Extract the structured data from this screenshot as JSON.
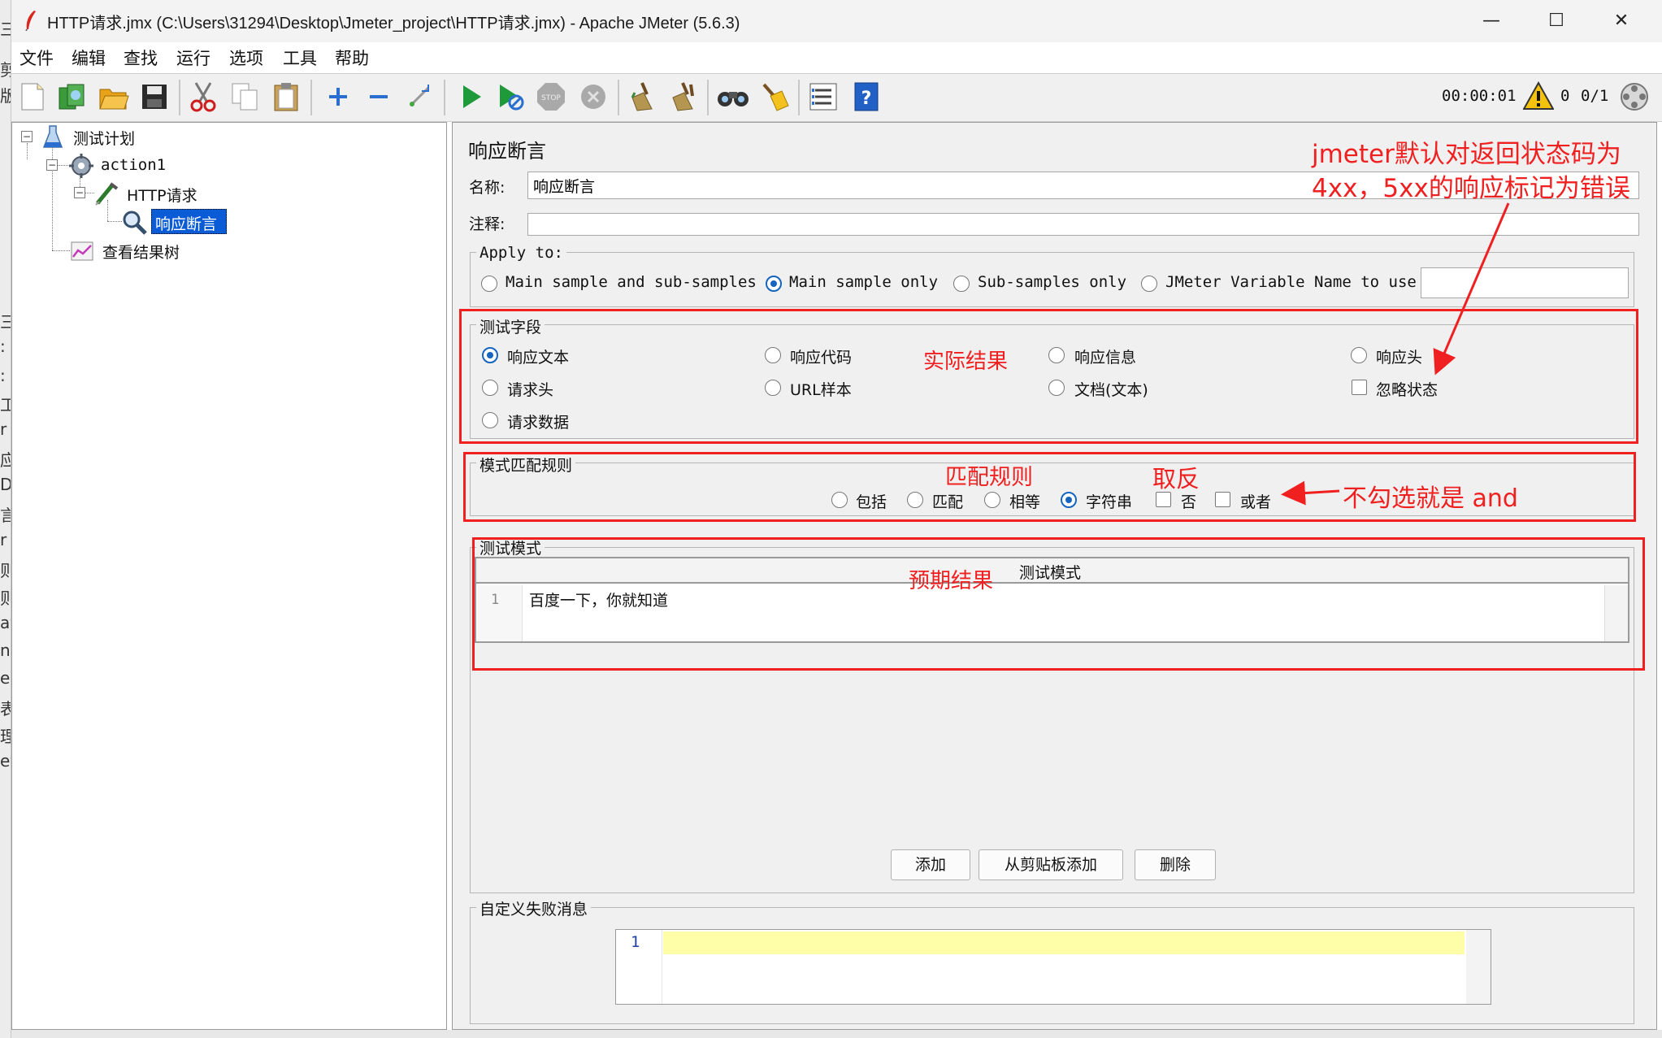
{
  "window": {
    "title": "HTTP请求.jmx (C:\\Users\\31294\\Desktop\\Jmeter_project\\HTTP请求.jmx) - Apache JMeter (5.6.3)",
    "minimize": "—",
    "maximize": "☐",
    "close": "✕"
  },
  "menu": [
    "文件",
    "编辑",
    "查找",
    "运行",
    "选项",
    "工具",
    "帮助"
  ],
  "toolbar": {
    "icons": [
      "new-icon",
      "templates-icon",
      "open-icon",
      "save-icon",
      "cut-icon",
      "copy-icon",
      "paste-icon",
      "expand-icon",
      "collapse-icon",
      "toggle-icon",
      "start-icon",
      "start-no-pause-icon",
      "stop-icon",
      "shutdown-icon",
      "clear-icon",
      "clear-all-icon",
      "search-icon",
      "reset-search-icon",
      "function-helper-icon",
      "help-icon"
    ],
    "timer": "00:00:01",
    "warn_count": "0",
    "threads": "0/1"
  },
  "tree": {
    "items": [
      {
        "label": "测试计划",
        "icon": "test-plan-icon"
      },
      {
        "label": "action1",
        "icon": "thread-group-icon"
      },
      {
        "label": "HTTP请求",
        "icon": "sampler-icon"
      },
      {
        "label": "响应断言",
        "icon": "assertion-icon"
      },
      {
        "label": "查看结果树",
        "icon": "listener-icon"
      }
    ]
  },
  "form": {
    "heading": "响应断言",
    "name_label": "名称:",
    "name_value": "响应断言",
    "comment_label": "注释:",
    "comment_value": "",
    "apply_to": {
      "legend": "Apply to:",
      "options": [
        "Main sample and sub-samples",
        "Main sample only",
        "Sub-samples only",
        "JMeter Variable Name to use"
      ],
      "selected": "Main sample only",
      "variable_value": ""
    },
    "test_field": {
      "legend": "测试字段",
      "options": [
        "响应文本",
        "响应代码",
        "响应信息",
        "响应头",
        "请求头",
        "URL样本",
        "文档(文本)",
        "请求数据"
      ],
      "selected": "响应文本",
      "ignore_status": "忽略状态",
      "ignore_status_checked": false
    },
    "pattern_rules": {
      "legend": "模式匹配规则",
      "options": [
        "包括",
        "匹配",
        "相等",
        "字符串"
      ],
      "selected": "字符串",
      "not_label": "否",
      "or_label": "或者",
      "not_checked": false,
      "or_checked": false
    },
    "patterns": {
      "legend": "测试模式",
      "column_header": "测试模式",
      "rows": [
        {
          "line": "1",
          "text": "百度一下，你就知道"
        }
      ]
    },
    "buttons": {
      "add": "添加",
      "add_clipboard": "从剪贴板添加",
      "delete": "删除"
    },
    "failure_message": {
      "legend": "自定义失败消息",
      "line": "1",
      "value": ""
    }
  },
  "annotations": {
    "status_note_line1": "jmeter默认对返回状态码为",
    "status_note_line2": "4xx，5xx的响应标记为错误",
    "actual_result": "实际结果",
    "match_rule": "匹配规则",
    "negate": "取反",
    "unchecked_and": "不勾选就是 and",
    "expected_result": "预期结果"
  },
  "colors": {
    "annotation_red": "#f02020",
    "selection_blue": "#1565c0",
    "editor_highlight": "#fefea8"
  }
}
